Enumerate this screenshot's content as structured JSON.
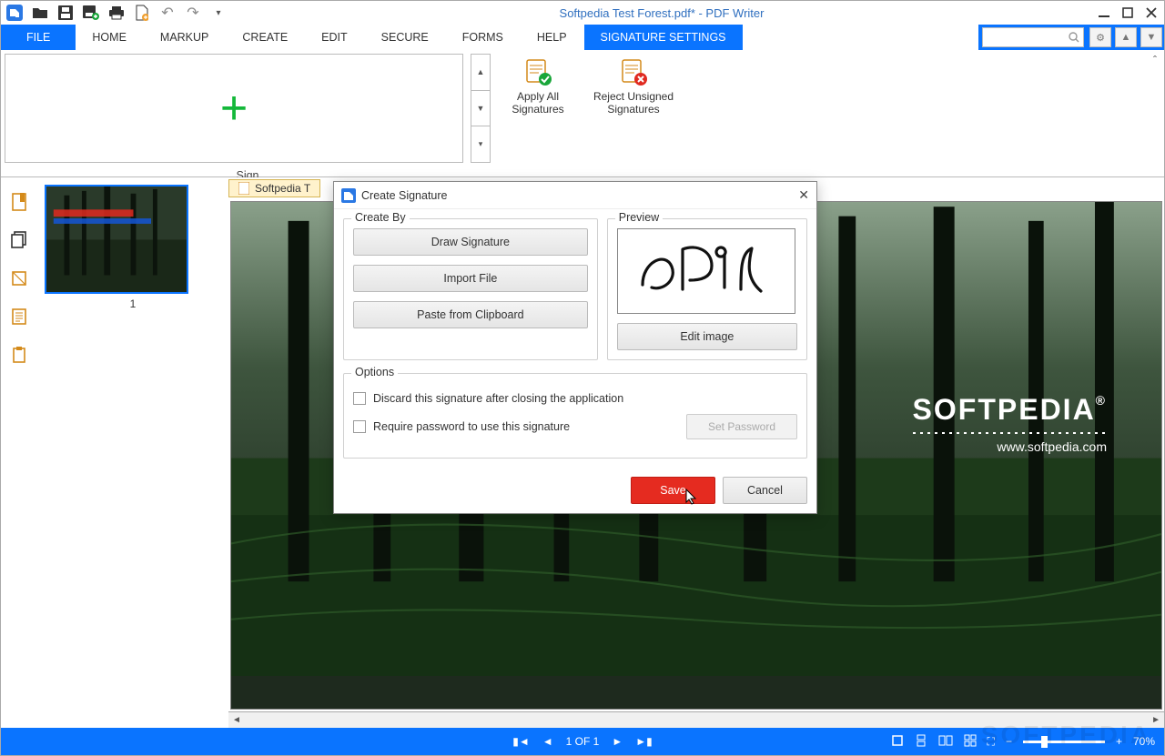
{
  "window": {
    "title": "Softpedia Test Forest.pdf* - PDF Writer"
  },
  "tabs": {
    "file": "FILE",
    "home": "HOME",
    "markup": "MARKUP",
    "create": "CREATE",
    "edit": "EDIT",
    "secure": "SECURE",
    "forms": "FORMS",
    "help": "HELP",
    "signature": "SIGNATURE SETTINGS"
  },
  "ribbon": {
    "sign_label": "Sign",
    "apply_all": "Apply All Signatures",
    "reject": "Reject Unsigned Signatures"
  },
  "doc": {
    "tab_label": "Softpedia T",
    "page_number": "1",
    "softpedia": "SOFTPEDIA",
    "reg": "®",
    "url": "www.softpedia.com"
  },
  "status": {
    "page": "1 OF 1",
    "zoom": "70%"
  },
  "dialog": {
    "title": "Create Signature",
    "create_by": "Create By",
    "draw": "Draw Signature",
    "import": "Import File",
    "paste": "Paste from Clipboard",
    "preview": "Preview",
    "edit_img": "Edit image",
    "options": "Options",
    "discard": "Discard this signature after closing the application",
    "require_pw": "Require password to use this signature",
    "set_pw": "Set Password",
    "save": "Save",
    "cancel": "Cancel"
  },
  "watermark": "SOFTPEDIA"
}
